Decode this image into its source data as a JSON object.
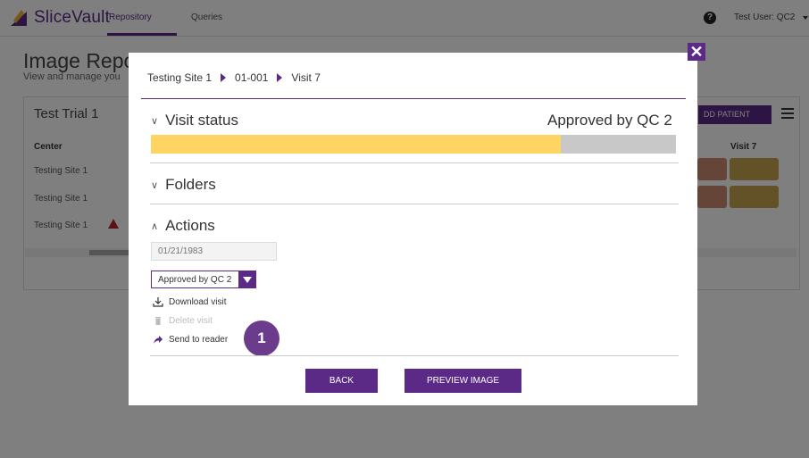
{
  "app": {
    "name": "SliceVault"
  },
  "nav": {
    "tabs": [
      {
        "label": "Repository"
      },
      {
        "label": "Queries"
      }
    ],
    "user": "Test User: QC2"
  },
  "background": {
    "title": "Image Repo",
    "subtitle": "View and manage you",
    "trial": "Test Trial 1",
    "add_patient": "DD PATIENT",
    "columns": {
      "center": "Center",
      "visit7": "Visit 7"
    },
    "rows": [
      {
        "center": "Testing Site 1"
      },
      {
        "center": "Testing Site 1"
      },
      {
        "center": "Testing Site 1"
      }
    ],
    "colors": {
      "cell_red": "#c98a6e",
      "cell_yellow": "#c7a44e"
    }
  },
  "modal": {
    "breadcrumb": [
      "Testing Site 1",
      "01-001",
      "Visit 7"
    ],
    "close_glyph": "✕",
    "visit_status": {
      "label": "Visit status",
      "status": "Approved by QC 2",
      "progress": 0.78,
      "fill_color": "#fed462",
      "track_color": "#c8c8c8"
    },
    "folders": {
      "label": "Folders"
    },
    "actions": {
      "label": "Actions",
      "date_placeholder": "01/21/1983",
      "status_select": "Approved by QC 2",
      "download": "Download visit",
      "delete": "Delete visit",
      "send": "Send to reader"
    },
    "badge": "1",
    "buttons": {
      "back": "BACK",
      "preview": "PREVIEW IMAGE"
    }
  },
  "colors": {
    "brand": "#5b2a86"
  }
}
